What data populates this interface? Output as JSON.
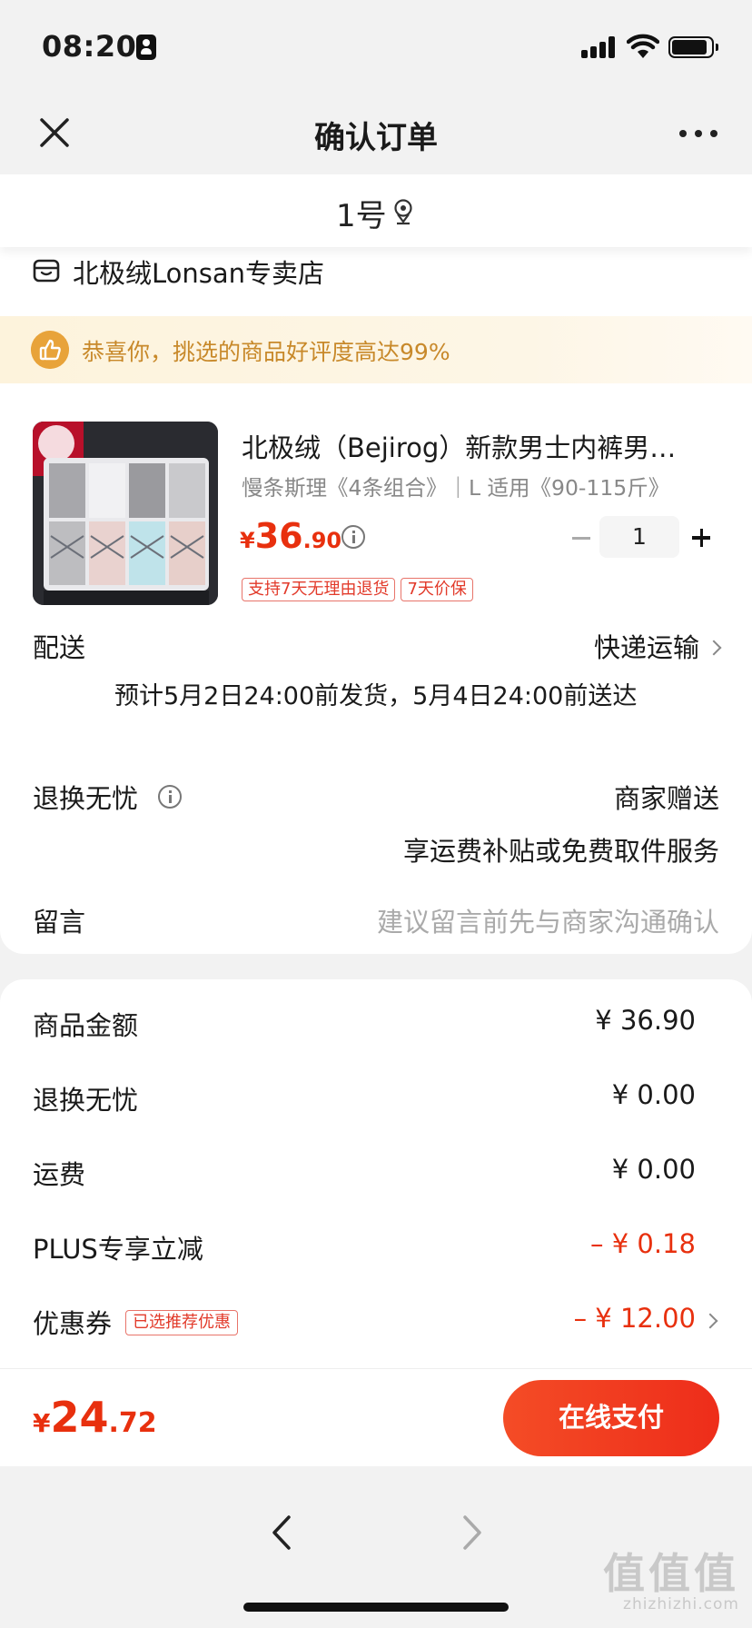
{
  "status_bar": {
    "time": "08:20"
  },
  "nav": {
    "title": "确认订单"
  },
  "address": {
    "label": "1号"
  },
  "store": {
    "name": "北极绒Lonsan专卖店"
  },
  "praise_banner": {
    "text": "恭喜你，挑选的商品好评度高达99%"
  },
  "product": {
    "title": "北极绒（Bejirog）新款男士内裤男…",
    "spec": "慢条斯理《4条组合》｜L 适用《90-115斤》",
    "price_currency": "¥",
    "price_int": "36",
    "price_dec": ".90",
    "quantity": "1",
    "tags": [
      "支持7天无理由退货",
      "7天价保"
    ]
  },
  "delivery": {
    "label": "配送",
    "method": "快递运输",
    "eta": "预计5月2日24:00前发货，5月4日24:00前送达"
  },
  "return_service": {
    "label": "退换无忧",
    "value": "商家赠送",
    "desc": "享运费补贴或免费取件服务"
  },
  "message": {
    "label": "留言",
    "placeholder": "建议留言前先与商家沟通确认"
  },
  "summary": {
    "goods_label": "商品金额",
    "goods_value": "¥ 36.90",
    "return_label": "退换无忧",
    "return_value": "¥ 0.00",
    "shipping_label": "运费",
    "shipping_value": "¥ 0.00",
    "plus_label": "PLUS专享立减",
    "plus_value": "– ¥ 0.18",
    "coupon_label": "优惠券",
    "coupon_tag": "已选推荐优惠",
    "coupon_value": "– ¥ 12.00"
  },
  "pay_bar": {
    "currency": "¥",
    "total_int": "24",
    "total_dec": ".72",
    "pay_label": "在线支付"
  },
  "watermark": {
    "logo": "值值值",
    "url": "zhizhizhi.com"
  },
  "colors": {
    "accent_red": "#e8300e",
    "banner_gold": "#c8892a",
    "pay_gradient_start": "#f44c26",
    "pay_gradient_end": "#ee2d1a"
  }
}
